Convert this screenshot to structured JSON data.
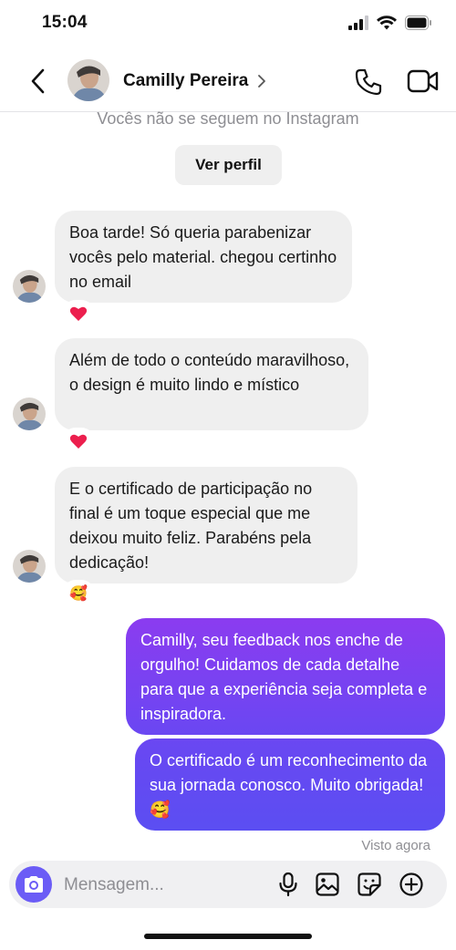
{
  "status_bar": {
    "time": "15:04"
  },
  "header": {
    "contact_name": "Camilly Pereira"
  },
  "notice": {
    "text": "Vocês não se seguem no Instagram",
    "profile_button": "Ver perfil"
  },
  "messages": [
    {
      "direction": "in",
      "text": "Boa tarde! Só queria parabenizar vocês pelo material. chegou certinho no email",
      "reaction": "❤️"
    },
    {
      "direction": "in",
      "text": " Além de todo o conteúdo maravilhoso, o design é muito lindo e místico",
      "reaction": "❤️"
    },
    {
      "direction": "in",
      "text": " E o certificado de participação no final é um toque especial que me deixou muito feliz. Parabéns pela dedicação!",
      "reaction": "🥰"
    },
    {
      "direction": "out",
      "text": "Camilly, seu feedback nos enche de orgulho! Cuidamos de cada detalhe para que a experiência seja completa e inspiradora."
    },
    {
      "direction": "out",
      "text": "O certificado é um reconhecimento da sua jornada conosco. Muito obrigada! 🥰"
    }
  ],
  "seen_status": "Visto agora",
  "composer": {
    "placeholder": "Mensagem..."
  },
  "colors": {
    "accent": "#6b5cf6",
    "out_bubble_top": "#8b3cf0",
    "out_bubble_bottom": "#5b4ef2",
    "in_bubble": "#efefef"
  },
  "icons": [
    "back-icon",
    "chevron-right-icon",
    "phone-icon",
    "video-camera-icon",
    "camera-icon",
    "microphone-icon",
    "image-icon",
    "sticker-icon",
    "plus-circle-icon",
    "heart-icon"
  ]
}
